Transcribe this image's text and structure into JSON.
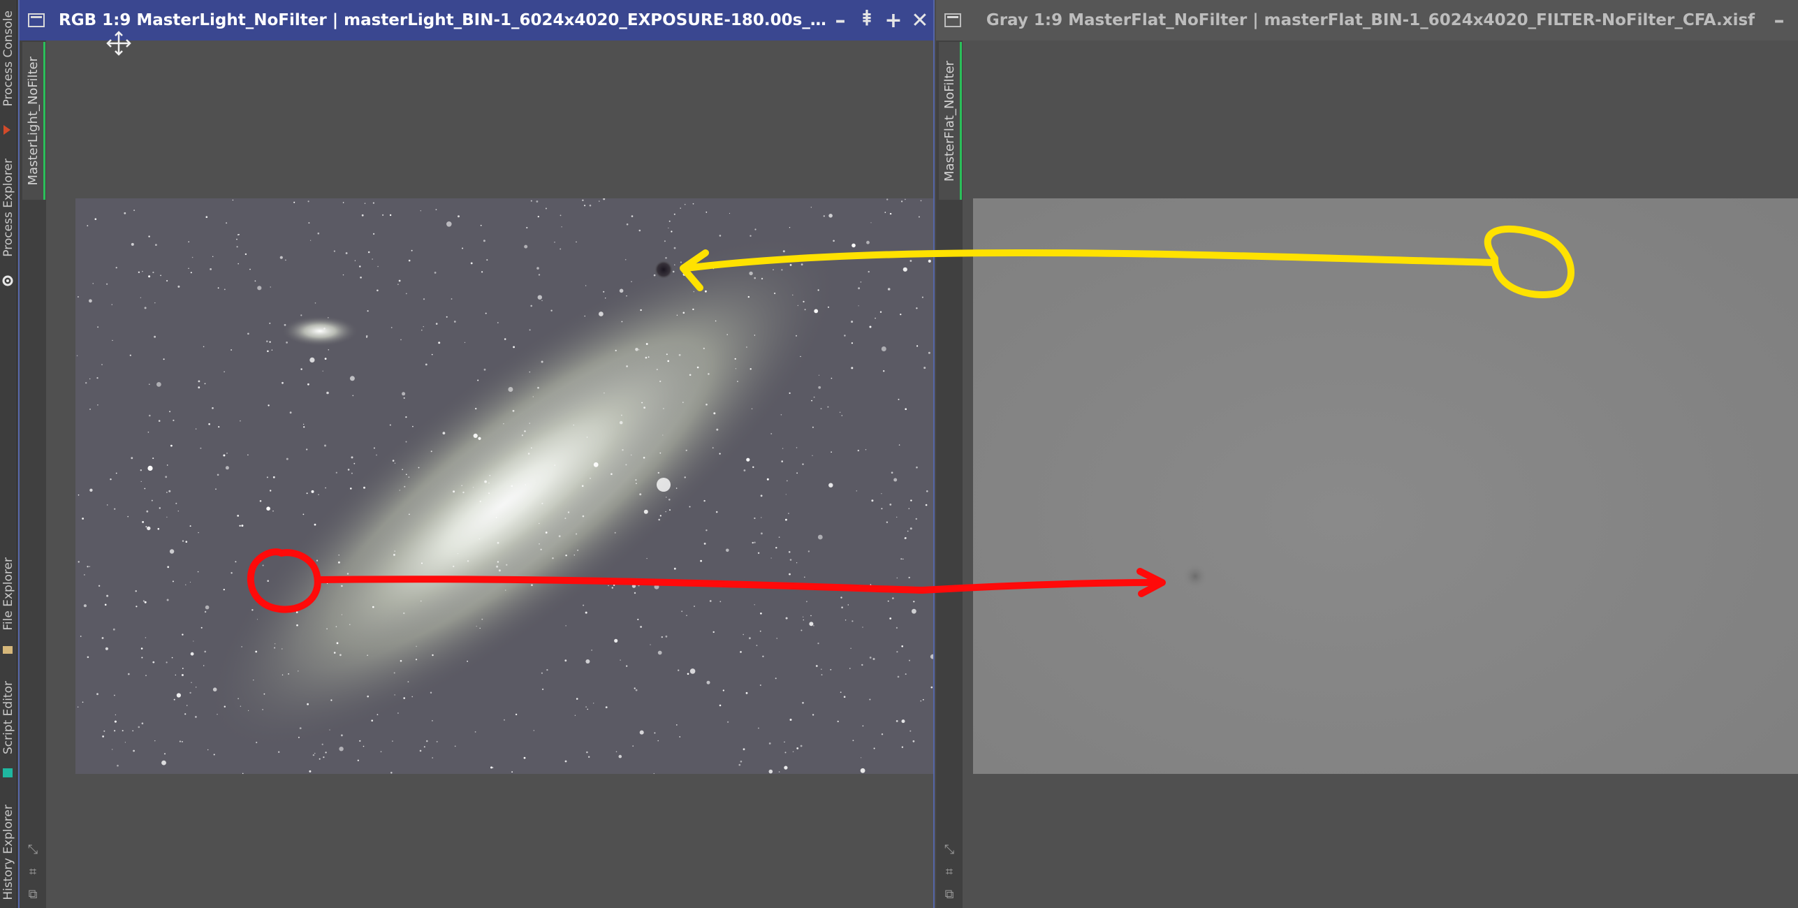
{
  "side_dock": {
    "tabs": [
      "Process Console",
      "Process Explorer",
      "File Explorer",
      "Script Editor",
      "History Explorer"
    ]
  },
  "windows": {
    "light": {
      "title": "RGB 1:9 MasterLight_NoFilter | masterLight_BIN-1_6024x4020_EXPOSURE-180.00s_FILTER-No...",
      "tab_label": "MasterLight_NoFilter",
      "buttons": [
        "–",
        "⯒",
        "+",
        "✕"
      ]
    },
    "flat": {
      "title": "Gray 1:9 MasterFlat_NoFilter | masterFlat_BIN-1_6024x4020_FILTER-NoFilter_CFA.xisf",
      "tab_label": "MasterFlat_NoFilter",
      "buttons": [
        "–"
      ]
    }
  },
  "annotations": {
    "yellow_color": "#ffe200",
    "red_color": "#ff0a0a"
  },
  "colors": {
    "active_title": "#3a4790",
    "inactive_title": "#565656",
    "flat_field": "#858585",
    "tab_indicator": "#2bbf5a"
  }
}
